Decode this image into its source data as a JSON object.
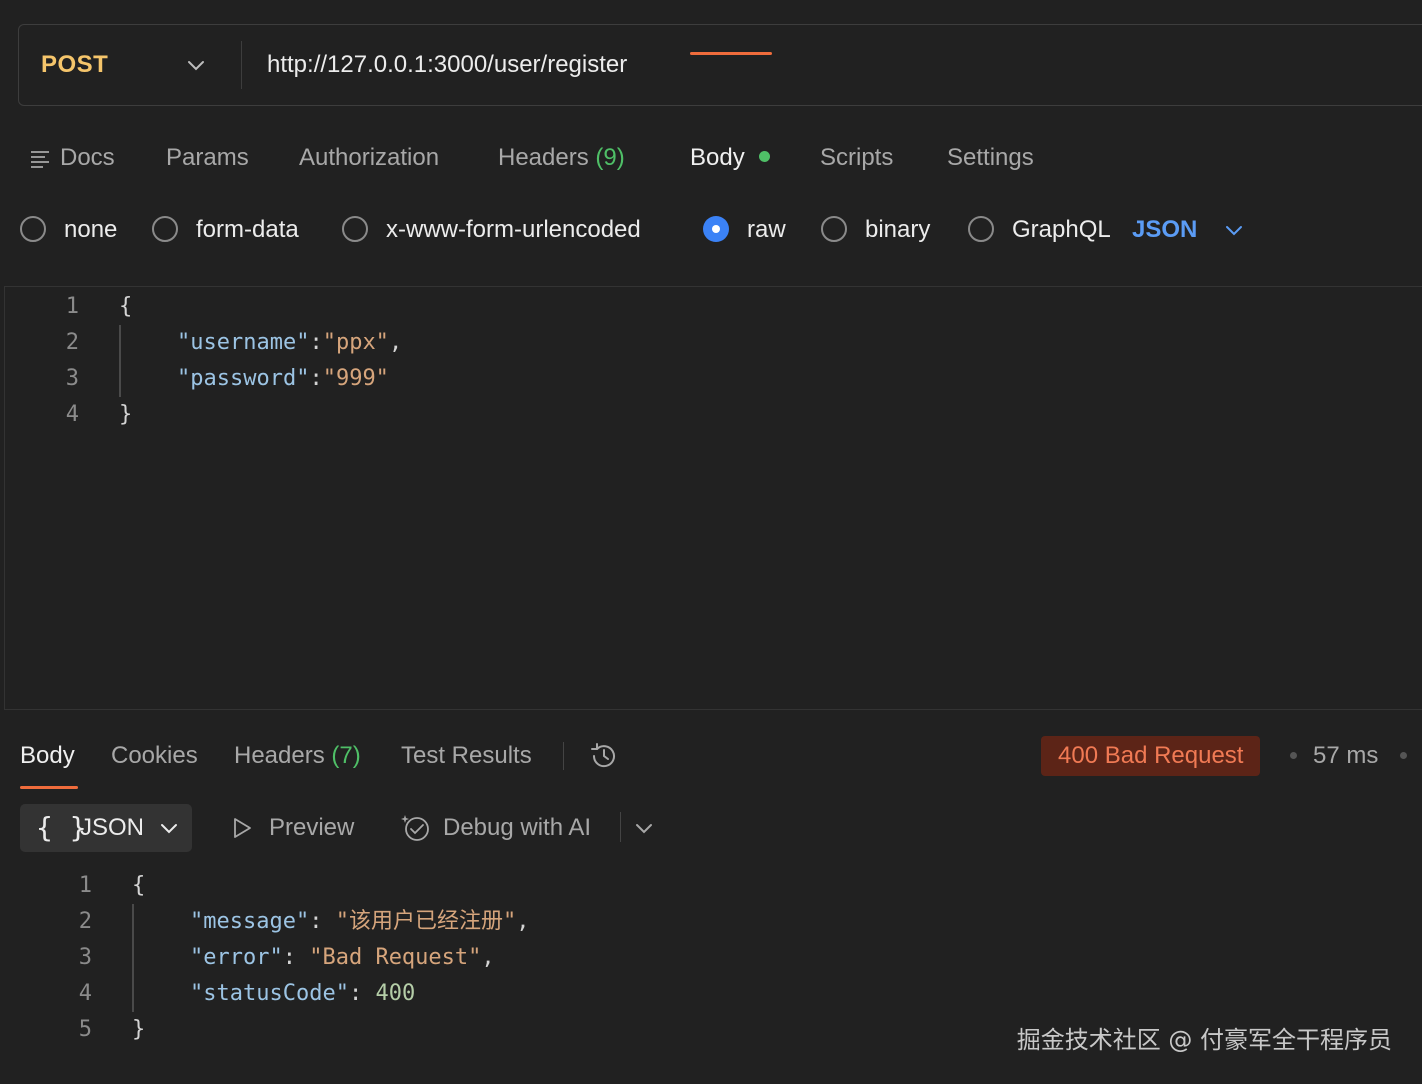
{
  "request": {
    "method": "POST",
    "url": "http://127.0.0.1:3000/user/register"
  },
  "request_tabs": {
    "docs": "Docs",
    "params": "Params",
    "authorization": "Authorization",
    "headers_label": "Headers",
    "headers_count": "(9)",
    "body": "Body",
    "scripts": "Scripts",
    "settings": "Settings"
  },
  "body_types": {
    "none": "none",
    "form_data": "form-data",
    "urlencoded": "x-www-form-urlencoded",
    "raw": "raw",
    "binary": "binary",
    "graphql": "GraphQL",
    "selected": "raw",
    "language": "JSON"
  },
  "request_body": {
    "line_numbers": [
      "1",
      "2",
      "3",
      "4"
    ],
    "open_brace": "{",
    "close_brace": "}",
    "username_key": "\"username\"",
    "username_value": "\"ppx\"",
    "password_key": "\"password\"",
    "password_value": "\"999\""
  },
  "response_tabs": {
    "body": "Body",
    "cookies": "Cookies",
    "headers_label": "Headers",
    "headers_count": "(7)",
    "test_results": "Test Results"
  },
  "response_status": {
    "status": "400 Bad Request",
    "time": "57 ms",
    "status_color": "#f07a54"
  },
  "response_toolbar": {
    "format_braces": "{ }",
    "format": "JSON",
    "preview": "Preview",
    "debug_ai": "Debug with AI"
  },
  "response_body": {
    "line_numbers": [
      "1",
      "2",
      "3",
      "4",
      "5"
    ],
    "open_brace": "{",
    "close_brace": "}",
    "message_key": "\"message\"",
    "message_value": "\"该用户已经注册\"",
    "error_key": "\"error\"",
    "error_value": "\"Bad Request\"",
    "status_key": "\"statusCode\"",
    "status_value": "400"
  },
  "watermark": "掘金技术社区 @ 付豪军全干程序员",
  "colors": {
    "background": "#212121",
    "method": "#f5c56b",
    "accent_tab": "#ef6c3c",
    "radio_checked": "#3b82f6",
    "dirty_dot": "#4fbf67"
  }
}
